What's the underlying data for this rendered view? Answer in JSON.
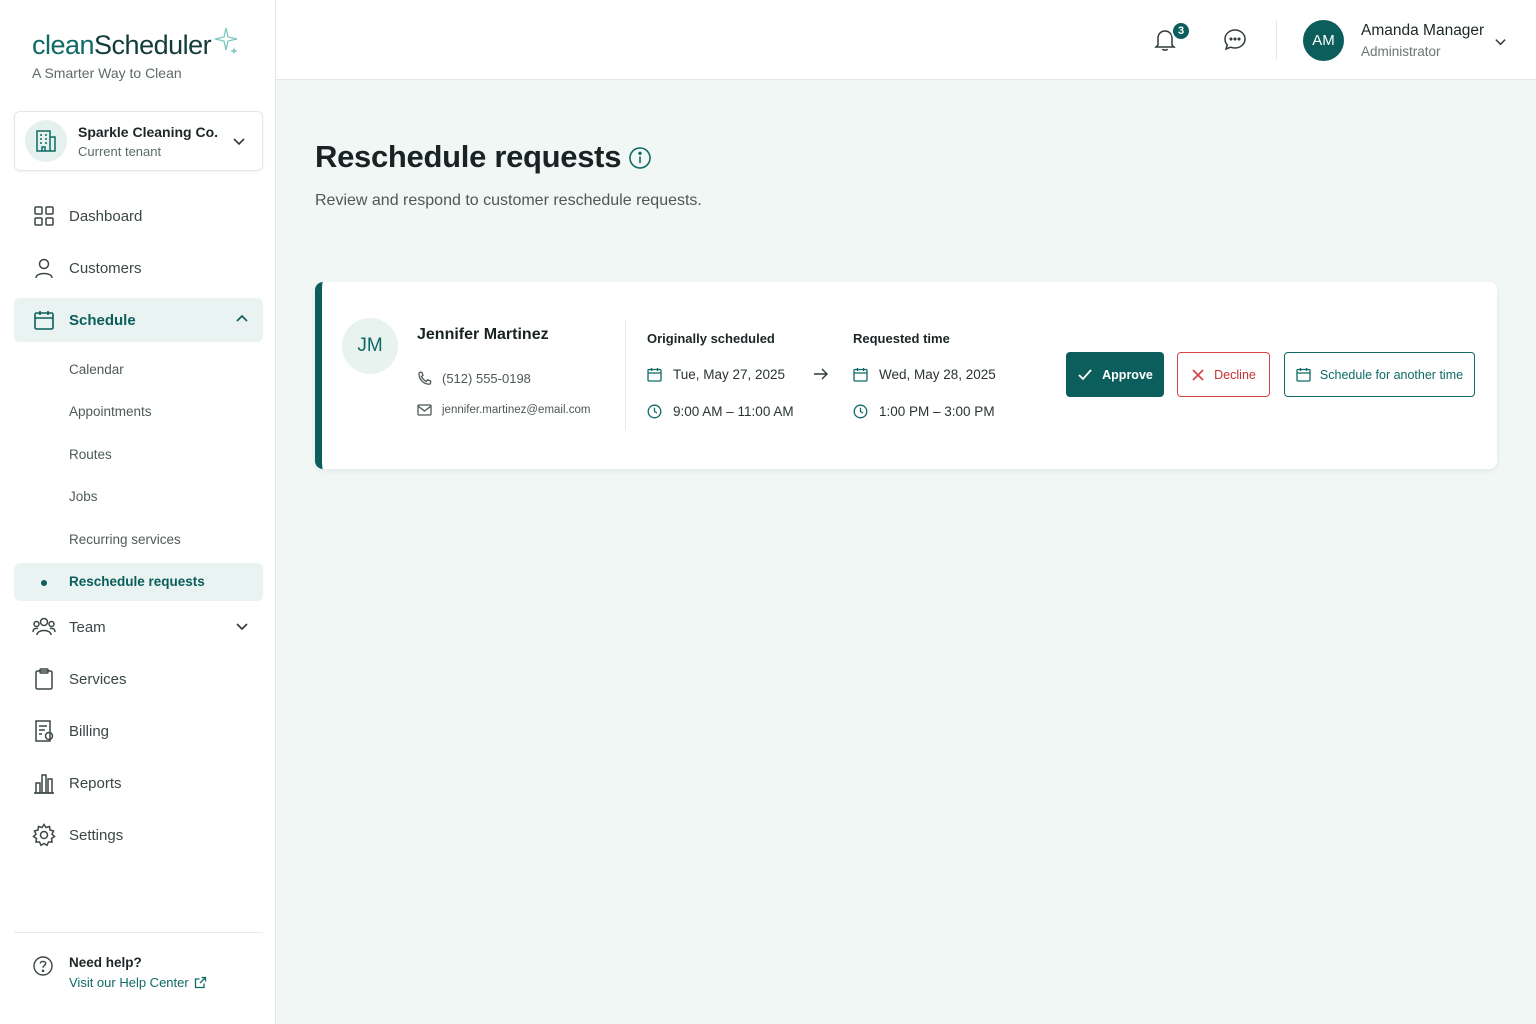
{
  "brand": {
    "logo_part1": "clean",
    "logo_part2": "Scheduler",
    "tagline": "A Smarter Way to Clean"
  },
  "tenant": {
    "name": "Sparkle Cleaning Co.",
    "subtitle": "Current tenant"
  },
  "nav": {
    "dashboard": "Dashboard",
    "customers": "Customers",
    "schedule": "Schedule",
    "schedule_sub": {
      "calendar": "Calendar",
      "appointments": "Appointments",
      "routes": "Routes",
      "jobs": "Jobs",
      "recurring": "Recurring services",
      "reschedule": "Reschedule requests"
    },
    "team": "Team",
    "services": "Services",
    "billing": "Billing",
    "reports": "Reports",
    "settings": "Settings"
  },
  "help": {
    "title": "Need help?",
    "link": "Visit our Help Center"
  },
  "header": {
    "notification_count": "3",
    "user_initials": "AM",
    "user_name": "Amanda Manager",
    "user_role": "Administrator"
  },
  "page": {
    "title": "Reschedule requests",
    "subtitle": "Review and respond to customer reschedule requests."
  },
  "request": {
    "initials": "JM",
    "name": "Jennifer Martinez",
    "phone": "(512) 555-0198",
    "email": "jennifer.martinez@email.com",
    "original_label": "Originally scheduled",
    "original_date": "Tue, May 27, 2025",
    "original_time": "9:00 AM – 11:00 AM",
    "requested_label": "Requested time",
    "requested_date": "Wed, May 28, 2025",
    "requested_time": "1:00 PM – 3:00 PM",
    "approve_label": "Approve",
    "decline_label": "Decline",
    "other_label": "Schedule for another time"
  },
  "colors": {
    "primary": "#0b5e5b",
    "danger": "#d64545",
    "background": "#f1f7f5"
  }
}
